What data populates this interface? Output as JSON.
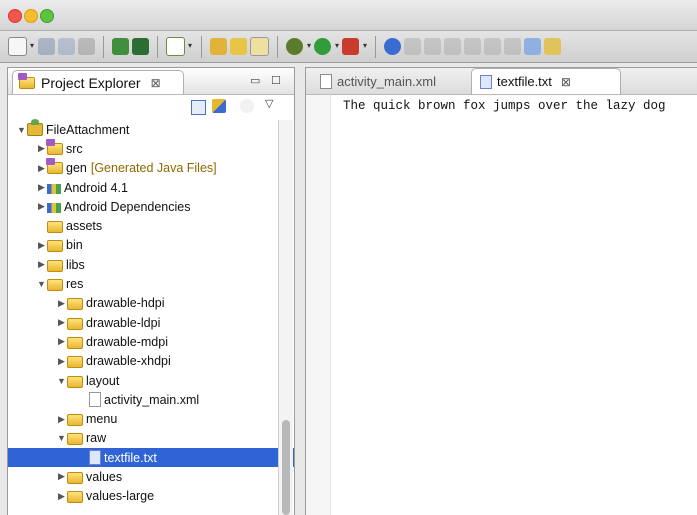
{
  "colors": {
    "selection": "#2f63d6",
    "generated": "#8a6a00"
  },
  "explorer": {
    "title": "Project Explorer",
    "close_glyph": "⊠",
    "minimize_glyph": "▭",
    "maximize_glyph": "☐",
    "menu_glyph": "▽",
    "tree": [
      {
        "label": "FileAttachment",
        "icon": "project-icon",
        "twisty": "▼",
        "indent": 0
      },
      {
        "label": "src",
        "icon": "package-folder-icon",
        "twisty": "▶",
        "indent": 1
      },
      {
        "label": "gen",
        "suffix": "[Generated Java Files]",
        "icon": "package-folder-icon",
        "twisty": "▶",
        "indent": 1
      },
      {
        "label": "Android 4.1",
        "icon": "library-icon",
        "twisty": "▶",
        "indent": 1
      },
      {
        "label": "Android Dependencies",
        "icon": "library-icon",
        "twisty": "▶",
        "indent": 1
      },
      {
        "label": "assets",
        "icon": "folder-icon",
        "twisty": "",
        "indent": 1
      },
      {
        "label": "bin",
        "icon": "folder-icon",
        "twisty": "▶",
        "indent": 1
      },
      {
        "label": "libs",
        "icon": "folder-icon",
        "twisty": "▶",
        "indent": 1
      },
      {
        "label": "res",
        "icon": "folder-icon",
        "twisty": "▼",
        "indent": 1
      },
      {
        "label": "drawable-hdpi",
        "icon": "folder-icon",
        "twisty": "▶",
        "indent": 2
      },
      {
        "label": "drawable-ldpi",
        "icon": "folder-icon",
        "twisty": "▶",
        "indent": 2
      },
      {
        "label": "drawable-mdpi",
        "icon": "folder-icon",
        "twisty": "▶",
        "indent": 2
      },
      {
        "label": "drawable-xhdpi",
        "icon": "folder-icon",
        "twisty": "▶",
        "indent": 2
      },
      {
        "label": "layout",
        "icon": "folder-icon",
        "twisty": "▼",
        "indent": 2
      },
      {
        "label": "activity_main.xml",
        "icon": "xml-file-icon",
        "twisty": "",
        "indent": 3
      },
      {
        "label": "menu",
        "icon": "folder-icon",
        "twisty": "▶",
        "indent": 2
      },
      {
        "label": "raw",
        "icon": "folder-icon",
        "twisty": "▼",
        "indent": 2
      },
      {
        "label": "textfile.txt",
        "icon": "text-file-icon",
        "twisty": "",
        "indent": 3,
        "selected": true
      },
      {
        "label": "values",
        "icon": "folder-icon",
        "twisty": "▶",
        "indent": 2
      },
      {
        "label": "values-large",
        "icon": "folder-icon",
        "twisty": "▶",
        "indent": 2
      }
    ]
  },
  "editor": {
    "tabs": [
      {
        "label": "activity_main.xml",
        "active": false
      },
      {
        "label": "textfile.txt",
        "active": true,
        "close_glyph": "⊠"
      }
    ],
    "content": "The quick brown fox jumps over the lazy dog"
  }
}
